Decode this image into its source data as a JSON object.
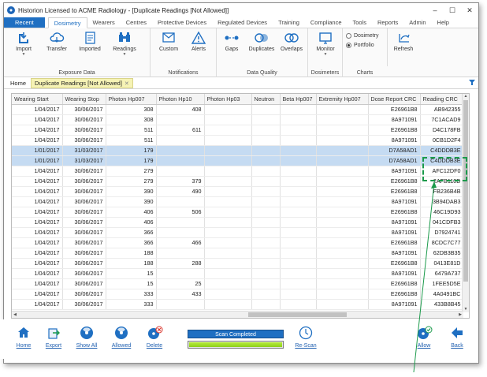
{
  "window": {
    "title": "Historion Licensed to ACME Radiology - [Duplicate Readings [Not Allowed]]",
    "min": "–",
    "max": "☐",
    "close": "✕"
  },
  "menu": {
    "items": [
      "Recent",
      "Dosimetry",
      "Wearers",
      "Centres",
      "Protective Devices",
      "Regulated Devices",
      "Training",
      "Compliance",
      "Tools",
      "Reports",
      "Admin",
      "Help"
    ],
    "active": "Dosimetry"
  },
  "ribbon": {
    "exposure_data": {
      "label": "Exposure Data",
      "buttons": [
        "Import",
        "Transfer",
        "Imported",
        "Readings"
      ]
    },
    "notifications": {
      "label": "Notifications",
      "buttons": [
        "Custom",
        "Alerts"
      ]
    },
    "data_quality": {
      "label": "Data Quality",
      "buttons": [
        "Gaps",
        "Duplicates",
        "Overlaps"
      ]
    },
    "dosimeters": {
      "label": "Dosimeters",
      "buttons": [
        "Monitor"
      ]
    },
    "charts": {
      "label": "Charts",
      "radio_dosimetry": "Dosimetry",
      "radio_portfolio": "Portfolio",
      "selected": "Portfolio",
      "refresh": "Refresh"
    }
  },
  "doc_tabs": {
    "home": "Home",
    "current": "Duplicate Readings [Not Allowed]",
    "close": "✕"
  },
  "grid": {
    "columns": [
      "Wearing Start",
      "Wearing Stop",
      "Photon Hp007",
      "Photon Hp10",
      "Photon Hp03",
      "Neutron",
      "Beta Hp007",
      "Extremity Hp007",
      "Dose Report CRC",
      "Reading CRC"
    ],
    "rows": [
      [
        "1/04/2017",
        "30/06/2017",
        "308",
        "408",
        "",
        "",
        "",
        "",
        "E26961B8",
        "AB942355"
      ],
      [
        "1/04/2017",
        "30/06/2017",
        "308",
        "",
        "",
        "",
        "",
        "",
        "8A971091",
        "7C1ACAD9"
      ],
      [
        "1/04/2017",
        "30/06/2017",
        "511",
        "611",
        "",
        "",
        "",
        "",
        "E26961B8",
        "D4C178FB"
      ],
      [
        "1/04/2017",
        "30/06/2017",
        "511",
        "",
        "",
        "",
        "",
        "",
        "8A971091",
        "0CB1D2F4"
      ],
      [
        "1/01/2017",
        "31/03/2017",
        "179",
        "",
        "",
        "",
        "",
        "",
        "D7A58AD1",
        "C4DDDB3E"
      ],
      [
        "1/01/2017",
        "31/03/2017",
        "179",
        "",
        "",
        "",
        "",
        "",
        "D7A58AD1",
        "C4DDDB3E"
      ],
      [
        "1/04/2017",
        "30/06/2017",
        "279",
        "",
        "",
        "",
        "",
        "",
        "8A971091",
        "AFC12DF0"
      ],
      [
        "1/04/2017",
        "30/06/2017",
        "279",
        "379",
        "",
        "",
        "",
        "",
        "E26961B8",
        "2AFB110D"
      ],
      [
        "1/04/2017",
        "30/06/2017",
        "390",
        "490",
        "",
        "",
        "",
        "",
        "E26961B8",
        "FB236B4B"
      ],
      [
        "1/04/2017",
        "30/06/2017",
        "390",
        "",
        "",
        "",
        "",
        "",
        "8A971091",
        "3B94DAB3"
      ],
      [
        "1/04/2017",
        "30/06/2017",
        "406",
        "506",
        "",
        "",
        "",
        "",
        "E26961B8",
        "46C19D93"
      ],
      [
        "1/04/2017",
        "30/06/2017",
        "406",
        "",
        "",
        "",
        "",
        "",
        "8A971091",
        "041CDFB3"
      ],
      [
        "1/04/2017",
        "30/06/2017",
        "366",
        "",
        "",
        "",
        "",
        "",
        "8A971091",
        "D7924741"
      ],
      [
        "1/04/2017",
        "30/06/2017",
        "366",
        "466",
        "",
        "",
        "",
        "",
        "E26961B8",
        "8CDC7C77"
      ],
      [
        "1/04/2017",
        "30/06/2017",
        "188",
        "",
        "",
        "",
        "",
        "",
        "8A971091",
        "62DB3B35"
      ],
      [
        "1/04/2017",
        "30/06/2017",
        "188",
        "288",
        "",
        "",
        "",
        "",
        "E26961B8",
        "0413E81D"
      ],
      [
        "1/04/2017",
        "30/06/2017",
        "15",
        "",
        "",
        "",
        "",
        "",
        "8A971091",
        "6479A737"
      ],
      [
        "1/04/2017",
        "30/06/2017",
        "15",
        "25",
        "",
        "",
        "",
        "",
        "E26961B8",
        "1FEE5D5E"
      ],
      [
        "1/04/2017",
        "30/06/2017",
        "333",
        "433",
        "",
        "",
        "",
        "",
        "E26961B8",
        "4A0491BC"
      ],
      [
        "1/04/2017",
        "30/06/2017",
        "333",
        "",
        "",
        "",
        "",
        "",
        "8A971091",
        "433B8B45"
      ]
    ],
    "highlighted_rows": [
      4,
      5
    ]
  },
  "bottom": {
    "buttons": [
      "Home",
      "Export",
      "Show All",
      "Allowed",
      "Delete",
      "Re-Scan",
      "Allow",
      "Back"
    ],
    "status": "Scan Completed",
    "progress": 1.0
  },
  "colors": {
    "accent": "#1f6fc2",
    "highlight_row": "#c5dbf2",
    "callout": "#1b9a4b"
  }
}
